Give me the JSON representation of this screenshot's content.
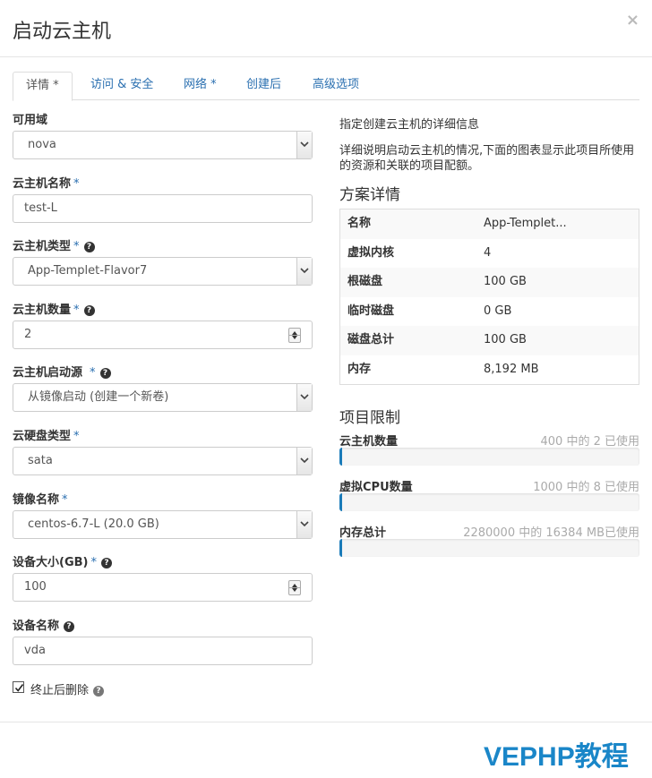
{
  "modal": {
    "title": "启动云主机",
    "close": "×"
  },
  "tabs": [
    {
      "label": "详情 *"
    },
    {
      "label": "访问 & 安全"
    },
    {
      "label": "网络 *"
    },
    {
      "label": "创建后"
    },
    {
      "label": "高级选项"
    }
  ],
  "form": {
    "availability_zone": {
      "label": "可用域",
      "value": "nova"
    },
    "instance_name": {
      "label": "云主机名称",
      "required": "*",
      "value": "test-L"
    },
    "flavor": {
      "label": "云主机类型",
      "required": "*",
      "value": "App-Templet-Flavor7"
    },
    "instance_count": {
      "label": "云主机数量",
      "required": "*",
      "value": "2"
    },
    "boot_source": {
      "label": "云主机启动源",
      "required": "*",
      "value": "从镜像启动 (创建一个新卷)"
    },
    "volume_type": {
      "label": "云硬盘类型",
      "required": "*",
      "value": "sata"
    },
    "image_name": {
      "label": "镜像名称",
      "required": "*",
      "value": "centos-6.7-L (20.0 GB)"
    },
    "device_size": {
      "label": "设备大小(GB)",
      "required": "*",
      "value": "100"
    },
    "device_name": {
      "label": "设备名称",
      "value": "vda"
    },
    "delete_on_terminate": {
      "label": "终止后删除",
      "checked": true
    }
  },
  "help_icon": "?",
  "side": {
    "intro": "指定创建云主机的详细信息",
    "description_line1": "详细说明启动云主机的情况,下面的图表显示此项目所使用",
    "description_line2": "的资源和关联的项目配额。",
    "flavor_title": "方案详情",
    "flavor_details": [
      {
        "key": "名称",
        "value": "App-Templet..."
      },
      {
        "key": "虚拟内核",
        "value": "4"
      },
      {
        "key": "根磁盘",
        "value": "100 GB"
      },
      {
        "key": "临时磁盘",
        "value": "0 GB"
      },
      {
        "key": "磁盘总计",
        "value": "100 GB"
      },
      {
        "key": "内存",
        "value": "8,192 MB"
      }
    ],
    "limits_title": "项目限制",
    "limits": [
      {
        "name": "云主机数量",
        "text": "400 中的 2 已使用",
        "used": 2,
        "total": 400
      },
      {
        "name": "虚拟CPU数量",
        "text": "1000 中的 8 已使用",
        "used": 8,
        "total": 1000
      },
      {
        "name": "内存总计",
        "text": "2280000 中的 16384 MB已使用",
        "used": 16384,
        "total": 2280000
      }
    ]
  },
  "watermark": "VEPHP教程",
  "colors": {
    "accent": "#2a6fb0",
    "progress": "#1a7bb9",
    "watermark": "#1a86c8"
  }
}
